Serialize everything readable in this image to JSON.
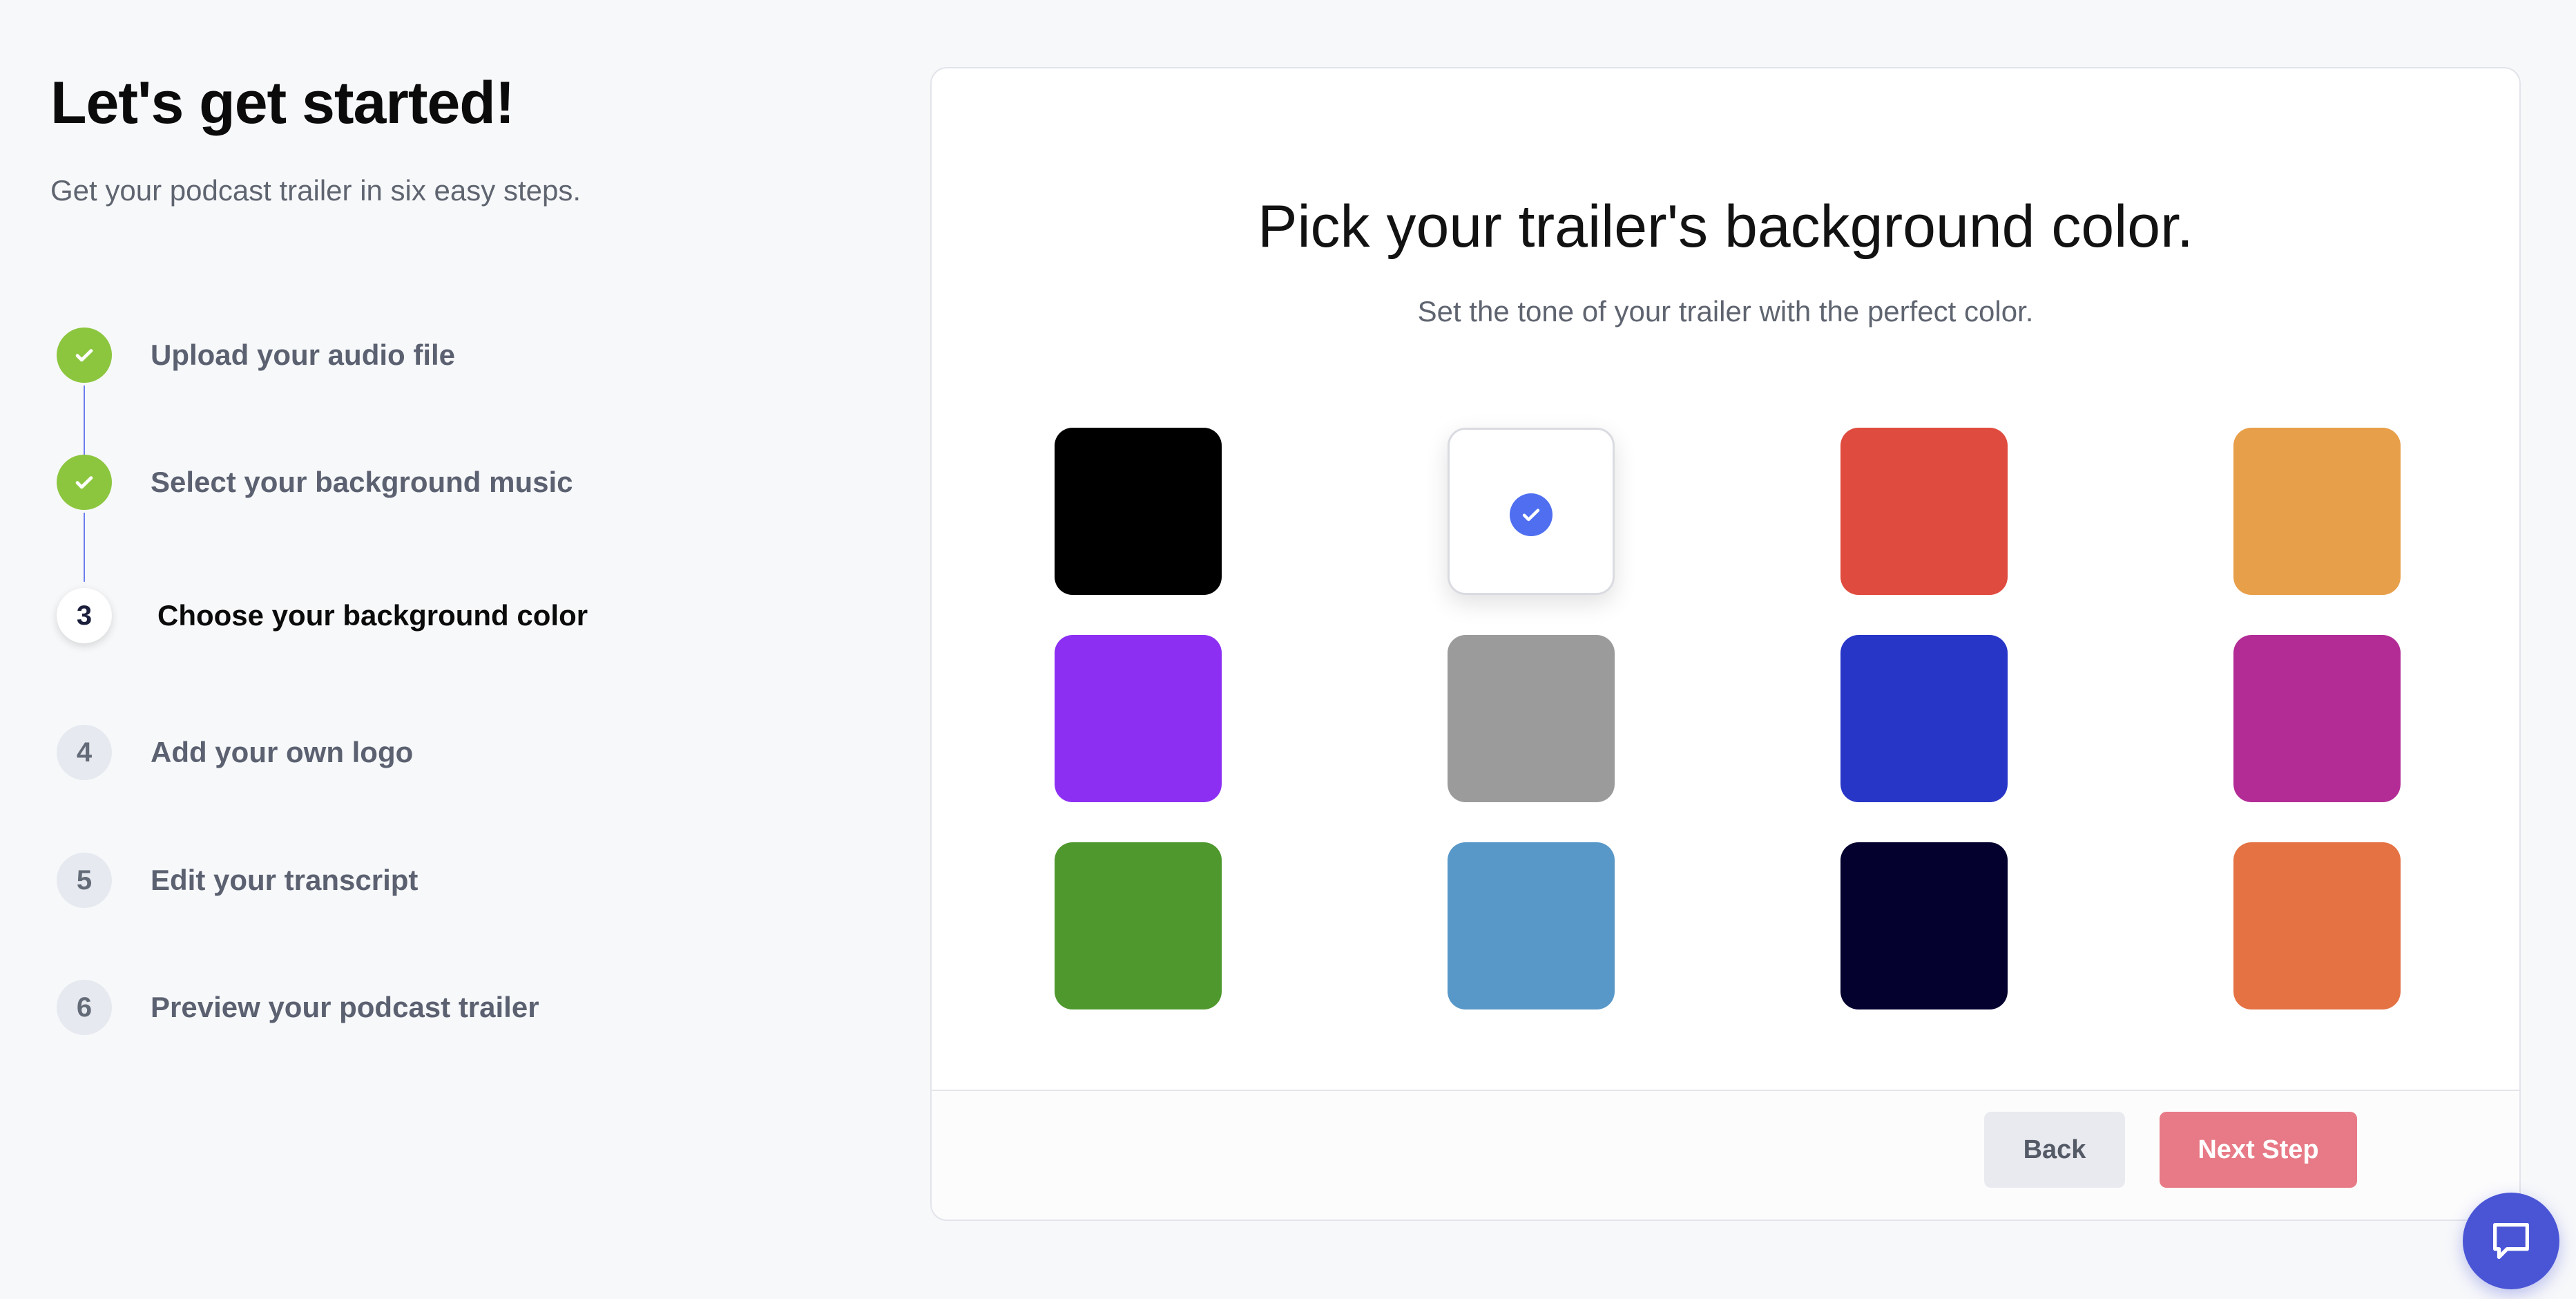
{
  "header": {
    "title": "Let's get started!",
    "subtitle": "Get your podcast trailer in six easy steps."
  },
  "steps": [
    {
      "number": "1",
      "label": "Upload your audio file",
      "status": "completed",
      "icon": "check-icon"
    },
    {
      "number": "2",
      "label": "Select your background music",
      "status": "completed",
      "icon": "check-icon"
    },
    {
      "number": "3",
      "label": "Choose your background color",
      "status": "current"
    },
    {
      "number": "4",
      "label": "Add your own logo",
      "status": "upcoming"
    },
    {
      "number": "5",
      "label": "Edit your transcript",
      "status": "upcoming"
    },
    {
      "number": "6",
      "label": "Preview your podcast trailer",
      "status": "upcoming"
    }
  ],
  "main": {
    "title": "Pick your trailer's background color.",
    "subtitle": "Set the tone of your trailer with the perfect color.",
    "colors": [
      {
        "name": "black",
        "hex": "#000000",
        "selected": false
      },
      {
        "name": "white",
        "hex": "#ffffff",
        "selected": true,
        "check_icon": "check-circle-icon",
        "check_color": "#4f6ff0"
      },
      {
        "name": "red",
        "hex": "#e04b3f",
        "selected": false
      },
      {
        "name": "amber",
        "hex": "#e89f49",
        "selected": false
      },
      {
        "name": "purple",
        "hex": "#8d2ff3",
        "selected": false
      },
      {
        "name": "gray",
        "hex": "#9b9b9b",
        "selected": false
      },
      {
        "name": "blue",
        "hex": "#2836c8",
        "selected": false
      },
      {
        "name": "magenta",
        "hex": "#b32c96",
        "selected": false
      },
      {
        "name": "green",
        "hex": "#4f982d",
        "selected": false
      },
      {
        "name": "sky-blue",
        "hex": "#5898c9",
        "selected": false
      },
      {
        "name": "navy",
        "hex": "#04012f",
        "selected": false
      },
      {
        "name": "orange",
        "hex": "#e47243",
        "selected": false
      }
    ]
  },
  "footer": {
    "back_label": "Back",
    "next_label": "Next Step"
  },
  "chat": {
    "icon": "chat-bubble-icon"
  },
  "theme": {
    "accent": "#4a55d6",
    "completed": "#8cc63f",
    "next_button": "#e77a86"
  }
}
